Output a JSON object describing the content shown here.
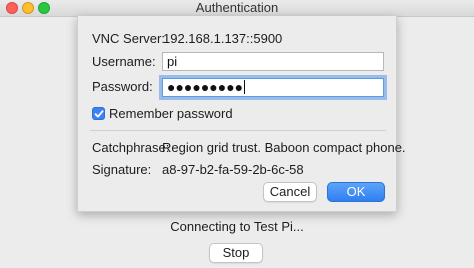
{
  "window": {
    "title": "Authentication"
  },
  "dialog": {
    "server_label": "VNC Server:",
    "server_value": "192.168.1.137::5900",
    "username_label": "Username:",
    "username_value": "pi",
    "password_label": "Password:",
    "password_masked": "●●●●●●●●●",
    "remember_label": "Remember password",
    "remember_checked": true,
    "catchphrase_label": "Catchphrase:",
    "catchphrase_value": "Region grid trust. Baboon compact phone.",
    "signature_label": "Signature:",
    "signature_value": "a8-97-b2-fa-59-2b-6c-58",
    "cancel_label": "Cancel",
    "ok_label": "OK"
  },
  "background": {
    "status_text": "Connecting to Test Pi...",
    "stop_label": "Stop"
  },
  "colors": {
    "accent": "#2f7ff0",
    "focus_ring": "#5596e6",
    "close": "#fe5f57",
    "minimize": "#febc2e",
    "maximize": "#28c840"
  },
  "icons": [
    "close-icon",
    "minimize-icon",
    "maximize-icon",
    "checkmark-icon"
  ]
}
